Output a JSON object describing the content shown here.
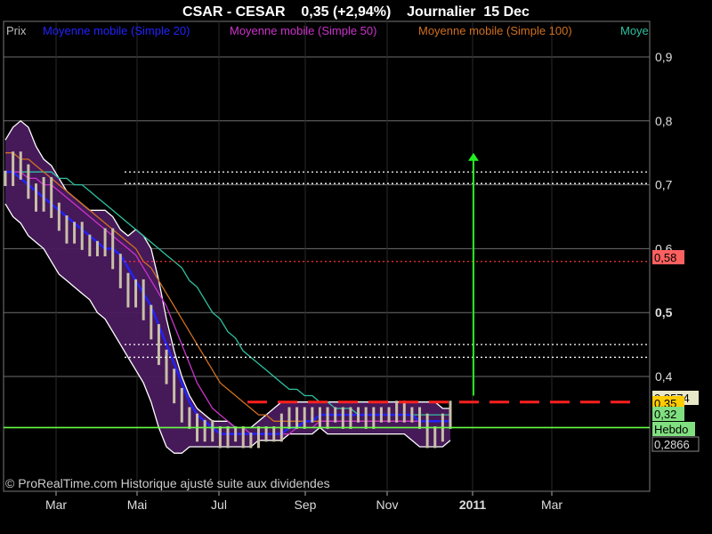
{
  "chart_data": {
    "type": "line",
    "title": "CSAR - CESAR    0,35 (+2,94%)    Journalier  15 Dec",
    "legend": {
      "position": "top-left",
      "items": [
        {
          "label": "Prix",
          "color": "#bbbbbb"
        },
        {
          "label": "Moyenne mobile (Simple 20)",
          "color": "#2222ff"
        },
        {
          "label": "Moyenne mobile (Simple 50)",
          "color": "#cc33cc"
        },
        {
          "label": "Moyenne mobile (Simple 100)",
          "color": "#d07020"
        },
        {
          "label": "Moye",
          "color": "#30c0a0"
        }
      ]
    },
    "footer": "© ProRealTime.com Historique ajusté suite aux dividendes",
    "x_tick_labels": [
      {
        "label": "Mar",
        "bold": false
      },
      {
        "label": "Mai",
        "bold": false
      },
      {
        "label": "Jul",
        "bold": false
      },
      {
        "label": "Sep",
        "bold": false
      },
      {
        "label": "Nov",
        "bold": false
      },
      {
        "label": "2011",
        "bold": true
      },
      {
        "label": "Mar",
        "bold": false
      }
    ],
    "y_tick_labels": [
      {
        "value": 0.9,
        "label": "0,9",
        "bold": false
      },
      {
        "value": 0.8,
        "label": "0,8",
        "bold": false
      },
      {
        "value": 0.7,
        "label": "0,7",
        "bold": false
      },
      {
        "value": 0.6,
        "label": "0,6",
        "bold": false
      },
      {
        "value": 0.5,
        "label": "0,5",
        "bold": true
      },
      {
        "value": 0.4,
        "label": "0,4",
        "bold": false
      }
    ],
    "ylim": [
      0.2,
      0.95
    ],
    "grid": true,
    "price_tags": [
      {
        "value": 0.58,
        "label": "0,58",
        "bg": "#ff6060"
      },
      {
        "value": 0.3574,
        "label": "0,3574",
        "bg": "#e8e8c8"
      },
      {
        "value": 0.35,
        "label": "0,35",
        "bg": "#ffcc00"
      },
      {
        "value": 0.32,
        "label": "0,32",
        "bg": "#80e080"
      },
      {
        "value": 0.305,
        "label": "Hebdo",
        "bg": "#80e080"
      },
      {
        "value": 0.2866,
        "label": "0,2866",
        "bg": "#000000"
      }
    ],
    "horizontal_lines": [
      {
        "value": 0.72,
        "color": "#ffffff",
        "style": "dotted"
      },
      {
        "value": 0.702,
        "color": "#ffffff",
        "style": "dotted"
      },
      {
        "value": 0.58,
        "color": "#ff3030",
        "style": "dotted"
      },
      {
        "value": 0.45,
        "color": "#ffffff",
        "style": "dotted"
      },
      {
        "value": 0.43,
        "color": "#ffffff",
        "style": "dotted"
      },
      {
        "value": 0.36,
        "color": "#ff2020",
        "style": "dashed"
      },
      {
        "value": 0.32,
        "color": "#66ff44",
        "style": "solid"
      }
    ],
    "arrow": {
      "from": 0.37,
      "to": 0.75,
      "color": "#22ee22"
    },
    "price_series": [
      {
        "t": 0,
        "v": 0.71
      },
      {
        "t": 2,
        "v": 0.74
      },
      {
        "t": 4,
        "v": 0.72
      },
      {
        "t": 6,
        "v": 0.69
      },
      {
        "t": 8,
        "v": 0.67
      },
      {
        "t": 10,
        "v": 0.7
      },
      {
        "t": 12,
        "v": 0.66
      },
      {
        "t": 14,
        "v": 0.64
      },
      {
        "t": 16,
        "v": 0.62
      },
      {
        "t": 18,
        "v": 0.63
      },
      {
        "t": 20,
        "v": 0.61
      },
      {
        "t": 22,
        "v": 0.6
      },
      {
        "t": 24,
        "v": 0.6
      },
      {
        "t": 26,
        "v": 0.62
      },
      {
        "t": 28,
        "v": 0.58
      },
      {
        "t": 30,
        "v": 0.55
      },
      {
        "t": 32,
        "v": 0.52
      },
      {
        "t": 34,
        "v": 0.54
      },
      {
        "t": 36,
        "v": 0.5
      },
      {
        "t": 38,
        "v": 0.47
      },
      {
        "t": 40,
        "v": 0.43
      },
      {
        "t": 42,
        "v": 0.4
      },
      {
        "t": 44,
        "v": 0.37
      },
      {
        "t": 46,
        "v": 0.34
      },
      {
        "t": 48,
        "v": 0.33
      },
      {
        "t": 50,
        "v": 0.31
      },
      {
        "t": 52,
        "v": 0.32
      },
      {
        "t": 54,
        "v": 0.31
      },
      {
        "t": 56,
        "v": 0.3
      },
      {
        "t": 58,
        "v": 0.31
      },
      {
        "t": 60,
        "v": 0.31
      },
      {
        "t": 62,
        "v": 0.3
      },
      {
        "t": 64,
        "v": 0.3
      },
      {
        "t": 66,
        "v": 0.31
      },
      {
        "t": 68,
        "v": 0.31
      },
      {
        "t": 70,
        "v": 0.31
      },
      {
        "t": 72,
        "v": 0.33
      },
      {
        "t": 74,
        "v": 0.34
      },
      {
        "t": 76,
        "v": 0.33
      },
      {
        "t": 78,
        "v": 0.34
      },
      {
        "t": 80,
        "v": 0.34
      },
      {
        "t": 82,
        "v": 0.33
      },
      {
        "t": 84,
        "v": 0.34
      },
      {
        "t": 86,
        "v": 0.34
      },
      {
        "t": 88,
        "v": 0.33
      },
      {
        "t": 90,
        "v": 0.34
      },
      {
        "t": 92,
        "v": 0.34
      },
      {
        "t": 94,
        "v": 0.33
      },
      {
        "t": 96,
        "v": 0.34
      },
      {
        "t": 98,
        "v": 0.34
      },
      {
        "t": 100,
        "v": 0.34
      },
      {
        "t": 102,
        "v": 0.35
      },
      {
        "t": 104,
        "v": 0.34
      },
      {
        "t": 106,
        "v": 0.34
      },
      {
        "t": 108,
        "v": 0.33
      },
      {
        "t": 110,
        "v": 0.3
      },
      {
        "t": 112,
        "v": 0.31
      },
      {
        "t": 114,
        "v": 0.33
      },
      {
        "t": 116,
        "v": 0.35
      }
    ],
    "series": [
      {
        "name": "Moyenne mobile (Simple 20)",
        "color": "#2222ff",
        "values": [
          0.72,
          0.72,
          0.71,
          0.7,
          0.69,
          0.68,
          0.67,
          0.66,
          0.65,
          0.64,
          0.63,
          0.62,
          0.61,
          0.6,
          0.6,
          0.59,
          0.57,
          0.55,
          0.53,
          0.51,
          0.48,
          0.45,
          0.42,
          0.39,
          0.36,
          0.34,
          0.33,
          0.32,
          0.31,
          0.31,
          0.31,
          0.31,
          0.31,
          0.31,
          0.31,
          0.31,
          0.31,
          0.32,
          0.32,
          0.33,
          0.33,
          0.34,
          0.34,
          0.34,
          0.34,
          0.34,
          0.34,
          0.34,
          0.34,
          0.34,
          0.34,
          0.34,
          0.34,
          0.34,
          0.33,
          0.33,
          0.33,
          0.33,
          0.33
        ]
      },
      {
        "name": "Moyenne mobile (Simple 50)",
        "color": "#cc33cc",
        "values": [
          0.72,
          0.72,
          0.72,
          0.71,
          0.71,
          0.7,
          0.7,
          0.69,
          0.68,
          0.67,
          0.66,
          0.65,
          0.64,
          0.63,
          0.62,
          0.61,
          0.6,
          0.59,
          0.57,
          0.55,
          0.53,
          0.51,
          0.48,
          0.45,
          0.42,
          0.39,
          0.37,
          0.35,
          0.34,
          0.33,
          0.32,
          0.32,
          0.31,
          0.31,
          0.31,
          0.31,
          0.31,
          0.31,
          0.32,
          0.32,
          0.32,
          0.33,
          0.33,
          0.33,
          0.33,
          0.33,
          0.33,
          0.33,
          0.33,
          0.33,
          0.33,
          0.33,
          0.33,
          0.33,
          0.33,
          0.33,
          0.33,
          0.33,
          0.33
        ]
      },
      {
        "name": "Moyenne mobile (Simple 100)",
        "color": "#d07020",
        "values": [
          0.75,
          0.75,
          0.74,
          0.74,
          0.73,
          0.72,
          0.71,
          0.7,
          0.69,
          0.68,
          0.67,
          0.66,
          0.65,
          0.64,
          0.63,
          0.62,
          0.61,
          0.6,
          0.58,
          0.57,
          0.55,
          0.53,
          0.51,
          0.49,
          0.47,
          0.45,
          0.43,
          0.41,
          0.39,
          0.38,
          0.37,
          0.36,
          0.35,
          0.34,
          0.34,
          0.33,
          0.33,
          0.33,
          0.33,
          0.33,
          0.33,
          0.33,
          0.33,
          0.33,
          0.33,
          0.33,
          0.33,
          0.33,
          0.33,
          0.33,
          0.33,
          0.33,
          0.33,
          0.33,
          0.33,
          0.33,
          0.33,
          0.33,
          0.33
        ]
      },
      {
        "name": "Moye",
        "color": "#30c0a0",
        "values": [
          0.72,
          0.72,
          0.72,
          0.72,
          0.72,
          0.72,
          0.72,
          0.71,
          0.71,
          0.7,
          0.7,
          0.69,
          0.68,
          0.67,
          0.66,
          0.65,
          0.64,
          0.63,
          0.62,
          0.61,
          0.6,
          0.59,
          0.58,
          0.57,
          0.55,
          0.54,
          0.52,
          0.5,
          0.49,
          0.47,
          0.46,
          0.44,
          0.43,
          0.42,
          0.41,
          0.4,
          0.39,
          0.38,
          0.38,
          0.37,
          0.37,
          0.36,
          0.36,
          0.35,
          0.35,
          0.35,
          0.34,
          0.34,
          0.34,
          0.34,
          0.34,
          0.34,
          0.34,
          0.34,
          0.34,
          0.34,
          0.34,
          0.34,
          0.34
        ]
      }
    ],
    "bollinger_upper": [
      0.77,
      0.79,
      0.8,
      0.79,
      0.76,
      0.74,
      0.73,
      0.71,
      0.69,
      0.68,
      0.67,
      0.66,
      0.66,
      0.66,
      0.65,
      0.63,
      0.62,
      0.63,
      0.62,
      0.6,
      0.55,
      0.49,
      0.44,
      0.4,
      0.37,
      0.35,
      0.34,
      0.33,
      0.33,
      0.33,
      0.32,
      0.32,
      0.32,
      0.33,
      0.34,
      0.35,
      0.36,
      0.36,
      0.36,
      0.36,
      0.36,
      0.36,
      0.36,
      0.36,
      0.36,
      0.36,
      0.36,
      0.36,
      0.36,
      0.36,
      0.36,
      0.36,
      0.36,
      0.36,
      0.36,
      0.36,
      0.36,
      0.35,
      0.35
    ],
    "bollinger_lower": [
      0.67,
      0.65,
      0.64,
      0.62,
      0.61,
      0.6,
      0.58,
      0.56,
      0.55,
      0.54,
      0.53,
      0.52,
      0.5,
      0.49,
      0.47,
      0.45,
      0.43,
      0.41,
      0.39,
      0.36,
      0.32,
      0.29,
      0.28,
      0.28,
      0.29,
      0.29,
      0.29,
      0.29,
      0.29,
      0.29,
      0.29,
      0.29,
      0.29,
      0.3,
      0.3,
      0.3,
      0.3,
      0.31,
      0.31,
      0.31,
      0.31,
      0.32,
      0.31,
      0.31,
      0.31,
      0.31,
      0.31,
      0.31,
      0.31,
      0.31,
      0.31,
      0.31,
      0.31,
      0.3,
      0.29,
      0.29,
      0.29,
      0.29,
      0.3
    ]
  }
}
